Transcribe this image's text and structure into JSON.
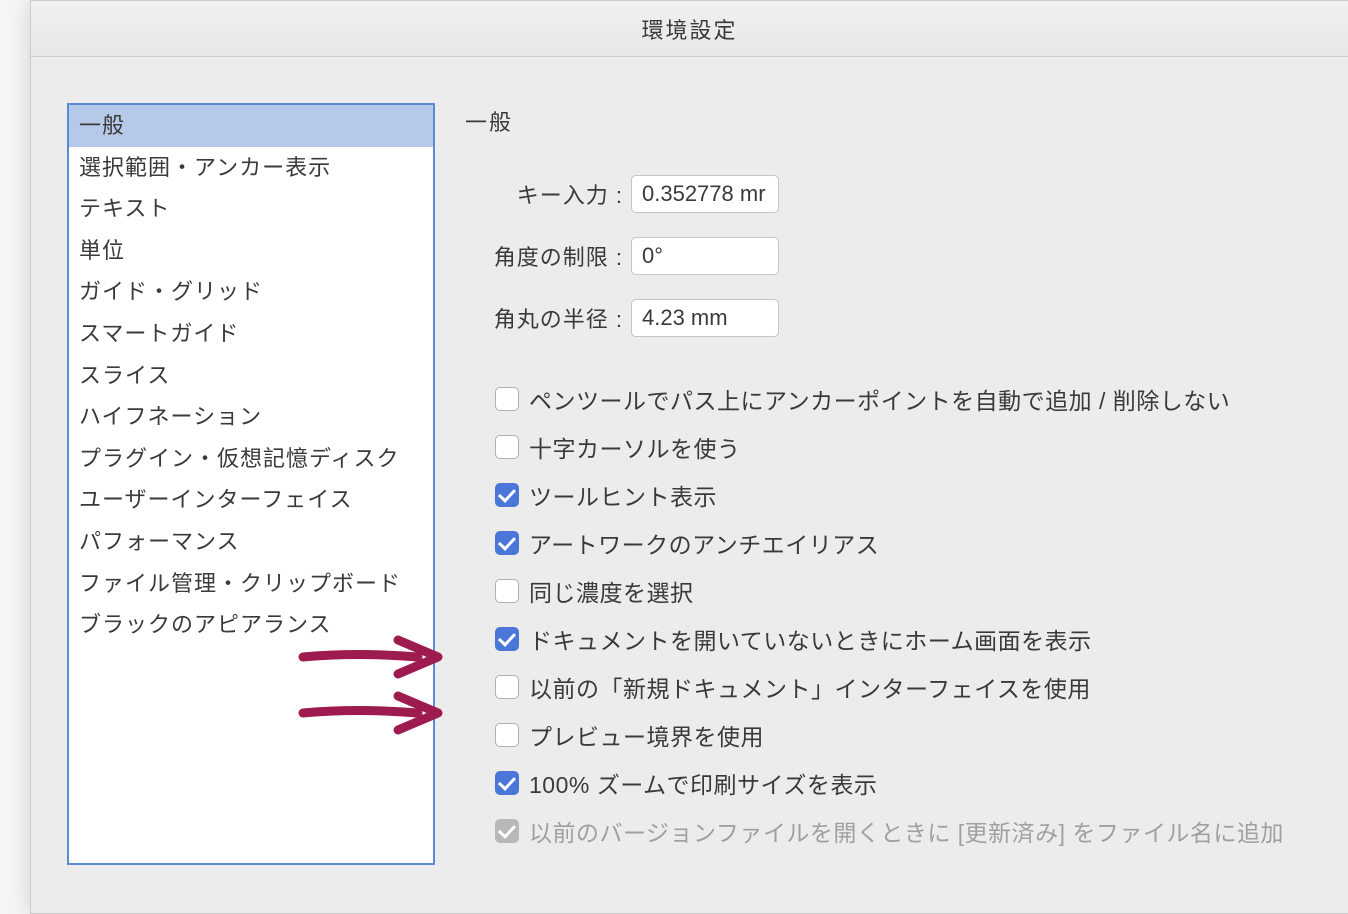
{
  "window": {
    "title": "環境設定"
  },
  "sidebar": {
    "items": [
      {
        "label": "一般",
        "selected": true
      },
      {
        "label": "選択範囲・アンカー表示",
        "selected": false
      },
      {
        "label": "テキスト",
        "selected": false
      },
      {
        "label": "単位",
        "selected": false
      },
      {
        "label": "ガイド・グリッド",
        "selected": false
      },
      {
        "label": "スマートガイド",
        "selected": false
      },
      {
        "label": "スライス",
        "selected": false
      },
      {
        "label": "ハイフネーション",
        "selected": false
      },
      {
        "label": "プラグイン・仮想記憶ディスク",
        "selected": false
      },
      {
        "label": "ユーザーインターフェイス",
        "selected": false
      },
      {
        "label": "パフォーマンス",
        "selected": false
      },
      {
        "label": "ファイル管理・クリップボード",
        "selected": false
      },
      {
        "label": "ブラックのアピアランス",
        "selected": false
      }
    ]
  },
  "main": {
    "title": "一般",
    "fields": {
      "keyInput": {
        "label": "キー入力 :",
        "value": "0.352778 mr"
      },
      "angleConstraint": {
        "label": "角度の制限 :",
        "value": "0°"
      },
      "cornerRadius": {
        "label": "角丸の半径 :",
        "value": "4.23 mm"
      }
    },
    "checkboxes": [
      {
        "label": "ペンツールでパス上にアンカーポイントを自動で追加 / 削除しない",
        "checked": false,
        "disabled": false
      },
      {
        "label": "十字カーソルを使う",
        "checked": false,
        "disabled": false
      },
      {
        "label": "ツールヒント表示",
        "checked": true,
        "disabled": false
      },
      {
        "label": "アートワークのアンチエイリアス",
        "checked": true,
        "disabled": false
      },
      {
        "label": "同じ濃度を選択",
        "checked": false,
        "disabled": false
      },
      {
        "label": "ドキュメントを開いていないときにホーム画面を表示",
        "checked": true,
        "disabled": false
      },
      {
        "label": "以前の「新規ドキュメント」インターフェイスを使用",
        "checked": false,
        "disabled": false
      },
      {
        "label": "プレビュー境界を使用",
        "checked": false,
        "disabled": false
      },
      {
        "label": "100% ズームで印刷サイズを表示",
        "checked": true,
        "disabled": false
      },
      {
        "label": "以前のバージョンファイルを開くときに [更新済み] をファイル名に追加",
        "checked": true,
        "disabled": true
      }
    ]
  },
  "annotations": {
    "arrowColor": "#9d1b4e"
  }
}
